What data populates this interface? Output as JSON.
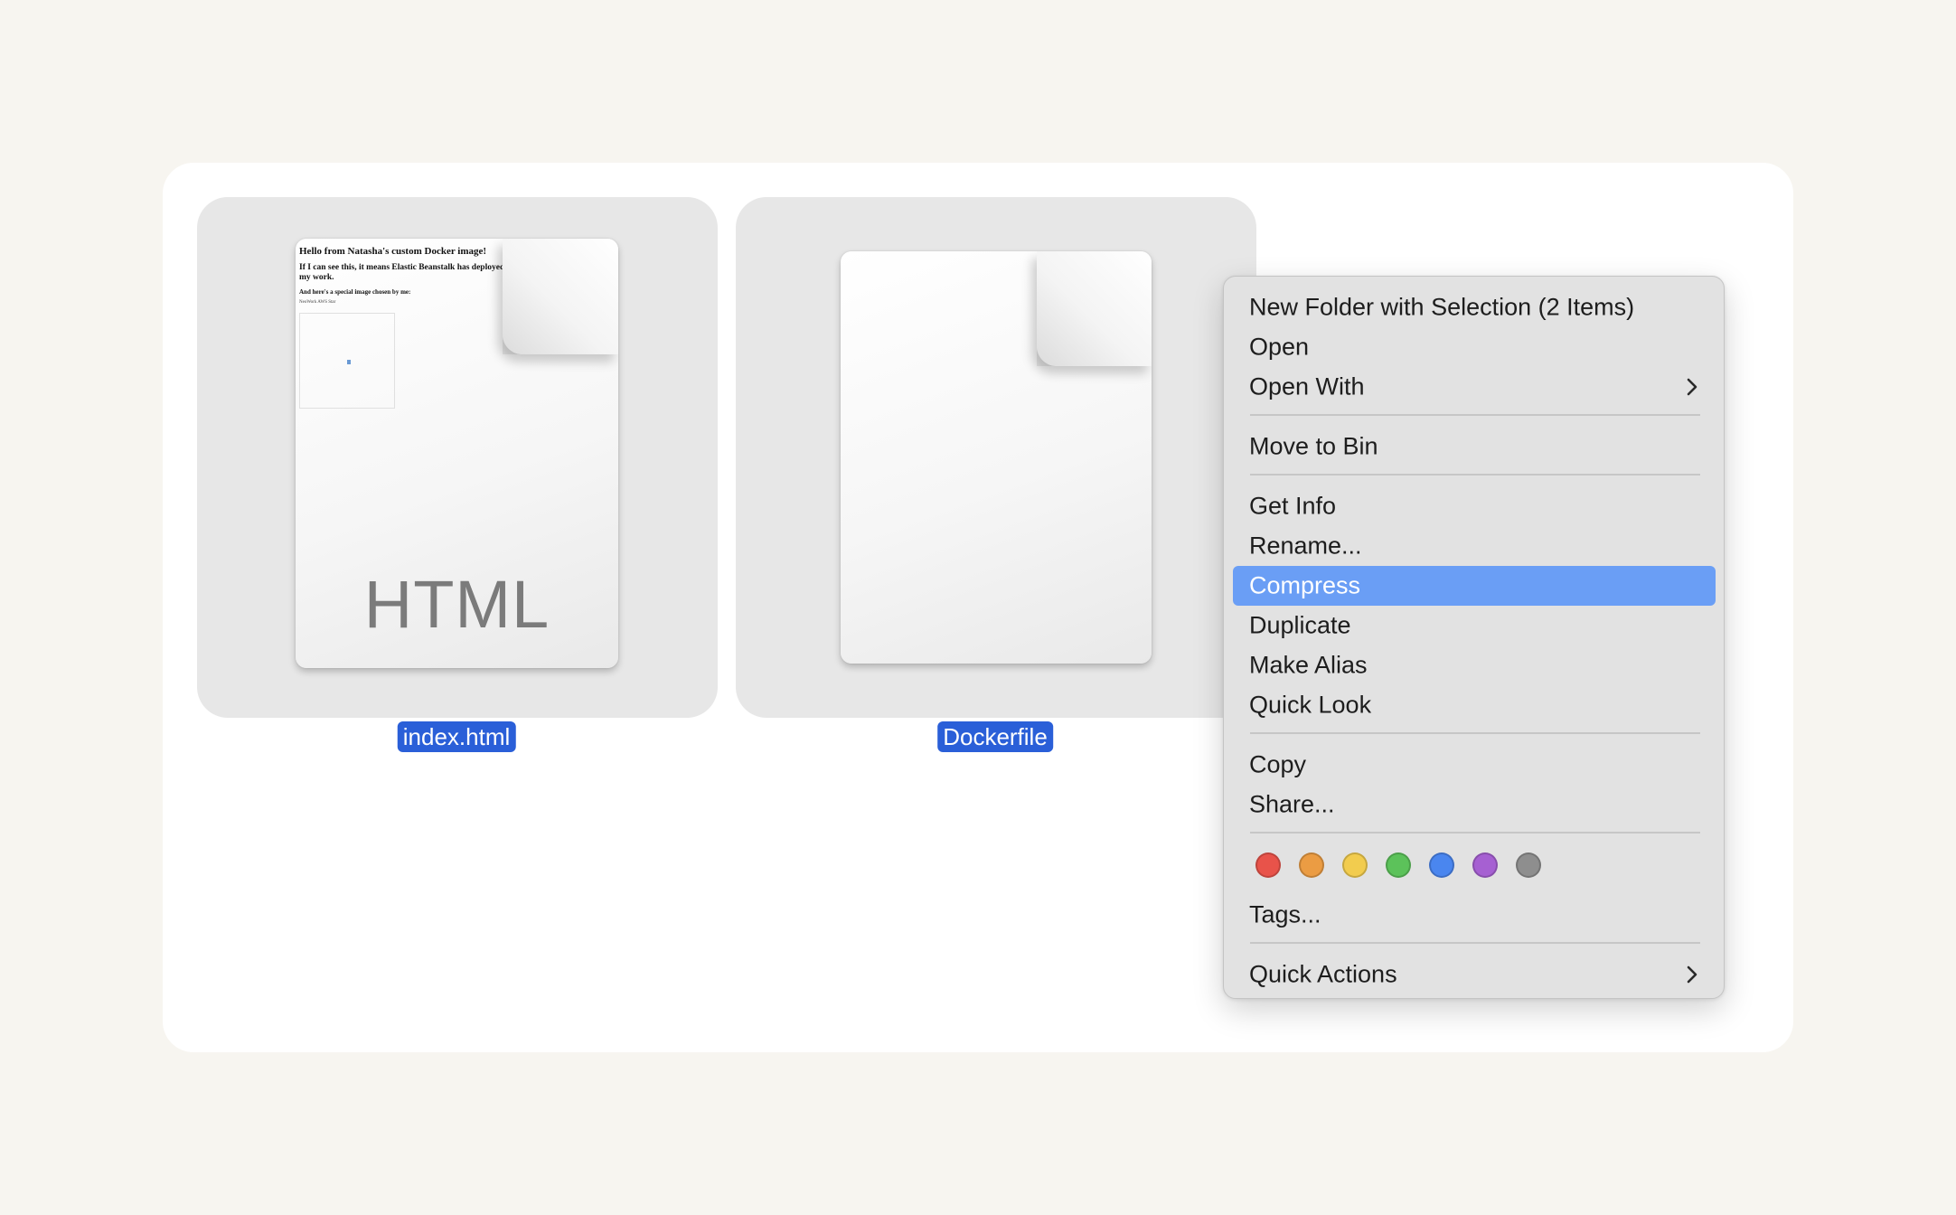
{
  "files": [
    {
      "name": "index.html",
      "type_label": "HTML",
      "preview": {
        "heading": "Hello from Natasha's custom Docker image!",
        "line2": "If I can see this, it means Elastic Beanstalk has deployed my work.",
        "line3": "And here's a special image chosen by me:",
        "image_caption": "NeoWork AWS Star"
      }
    },
    {
      "name": "Dockerfile"
    }
  ],
  "context_menu": {
    "new_folder": "New Folder with Selection (2 Items)",
    "open": "Open",
    "open_with": "Open With",
    "move_to_bin": "Move to Bin",
    "get_info": "Get Info",
    "rename": "Rename...",
    "compress": "Compress",
    "duplicate": "Duplicate",
    "make_alias": "Make Alias",
    "quick_look": "Quick Look",
    "copy": "Copy",
    "share": "Share...",
    "tags": "Tags...",
    "quick_actions": "Quick Actions",
    "highlighted_item": "Compress",
    "tag_colors": [
      {
        "name": "red",
        "color": "#e8534a"
      },
      {
        "name": "orange",
        "color": "#eb9c43"
      },
      {
        "name": "yellow",
        "color": "#f2cc4e"
      },
      {
        "name": "green",
        "color": "#5cc25a"
      },
      {
        "name": "blue",
        "color": "#4a86ef"
      },
      {
        "name": "purple",
        "color": "#a660d2"
      },
      {
        "name": "gray",
        "color": "#8e8e8e"
      }
    ]
  },
  "colors": {
    "selection": "#2a5fd8",
    "menu_highlight": "#6a9ef5",
    "background": "#f7f5f0"
  }
}
